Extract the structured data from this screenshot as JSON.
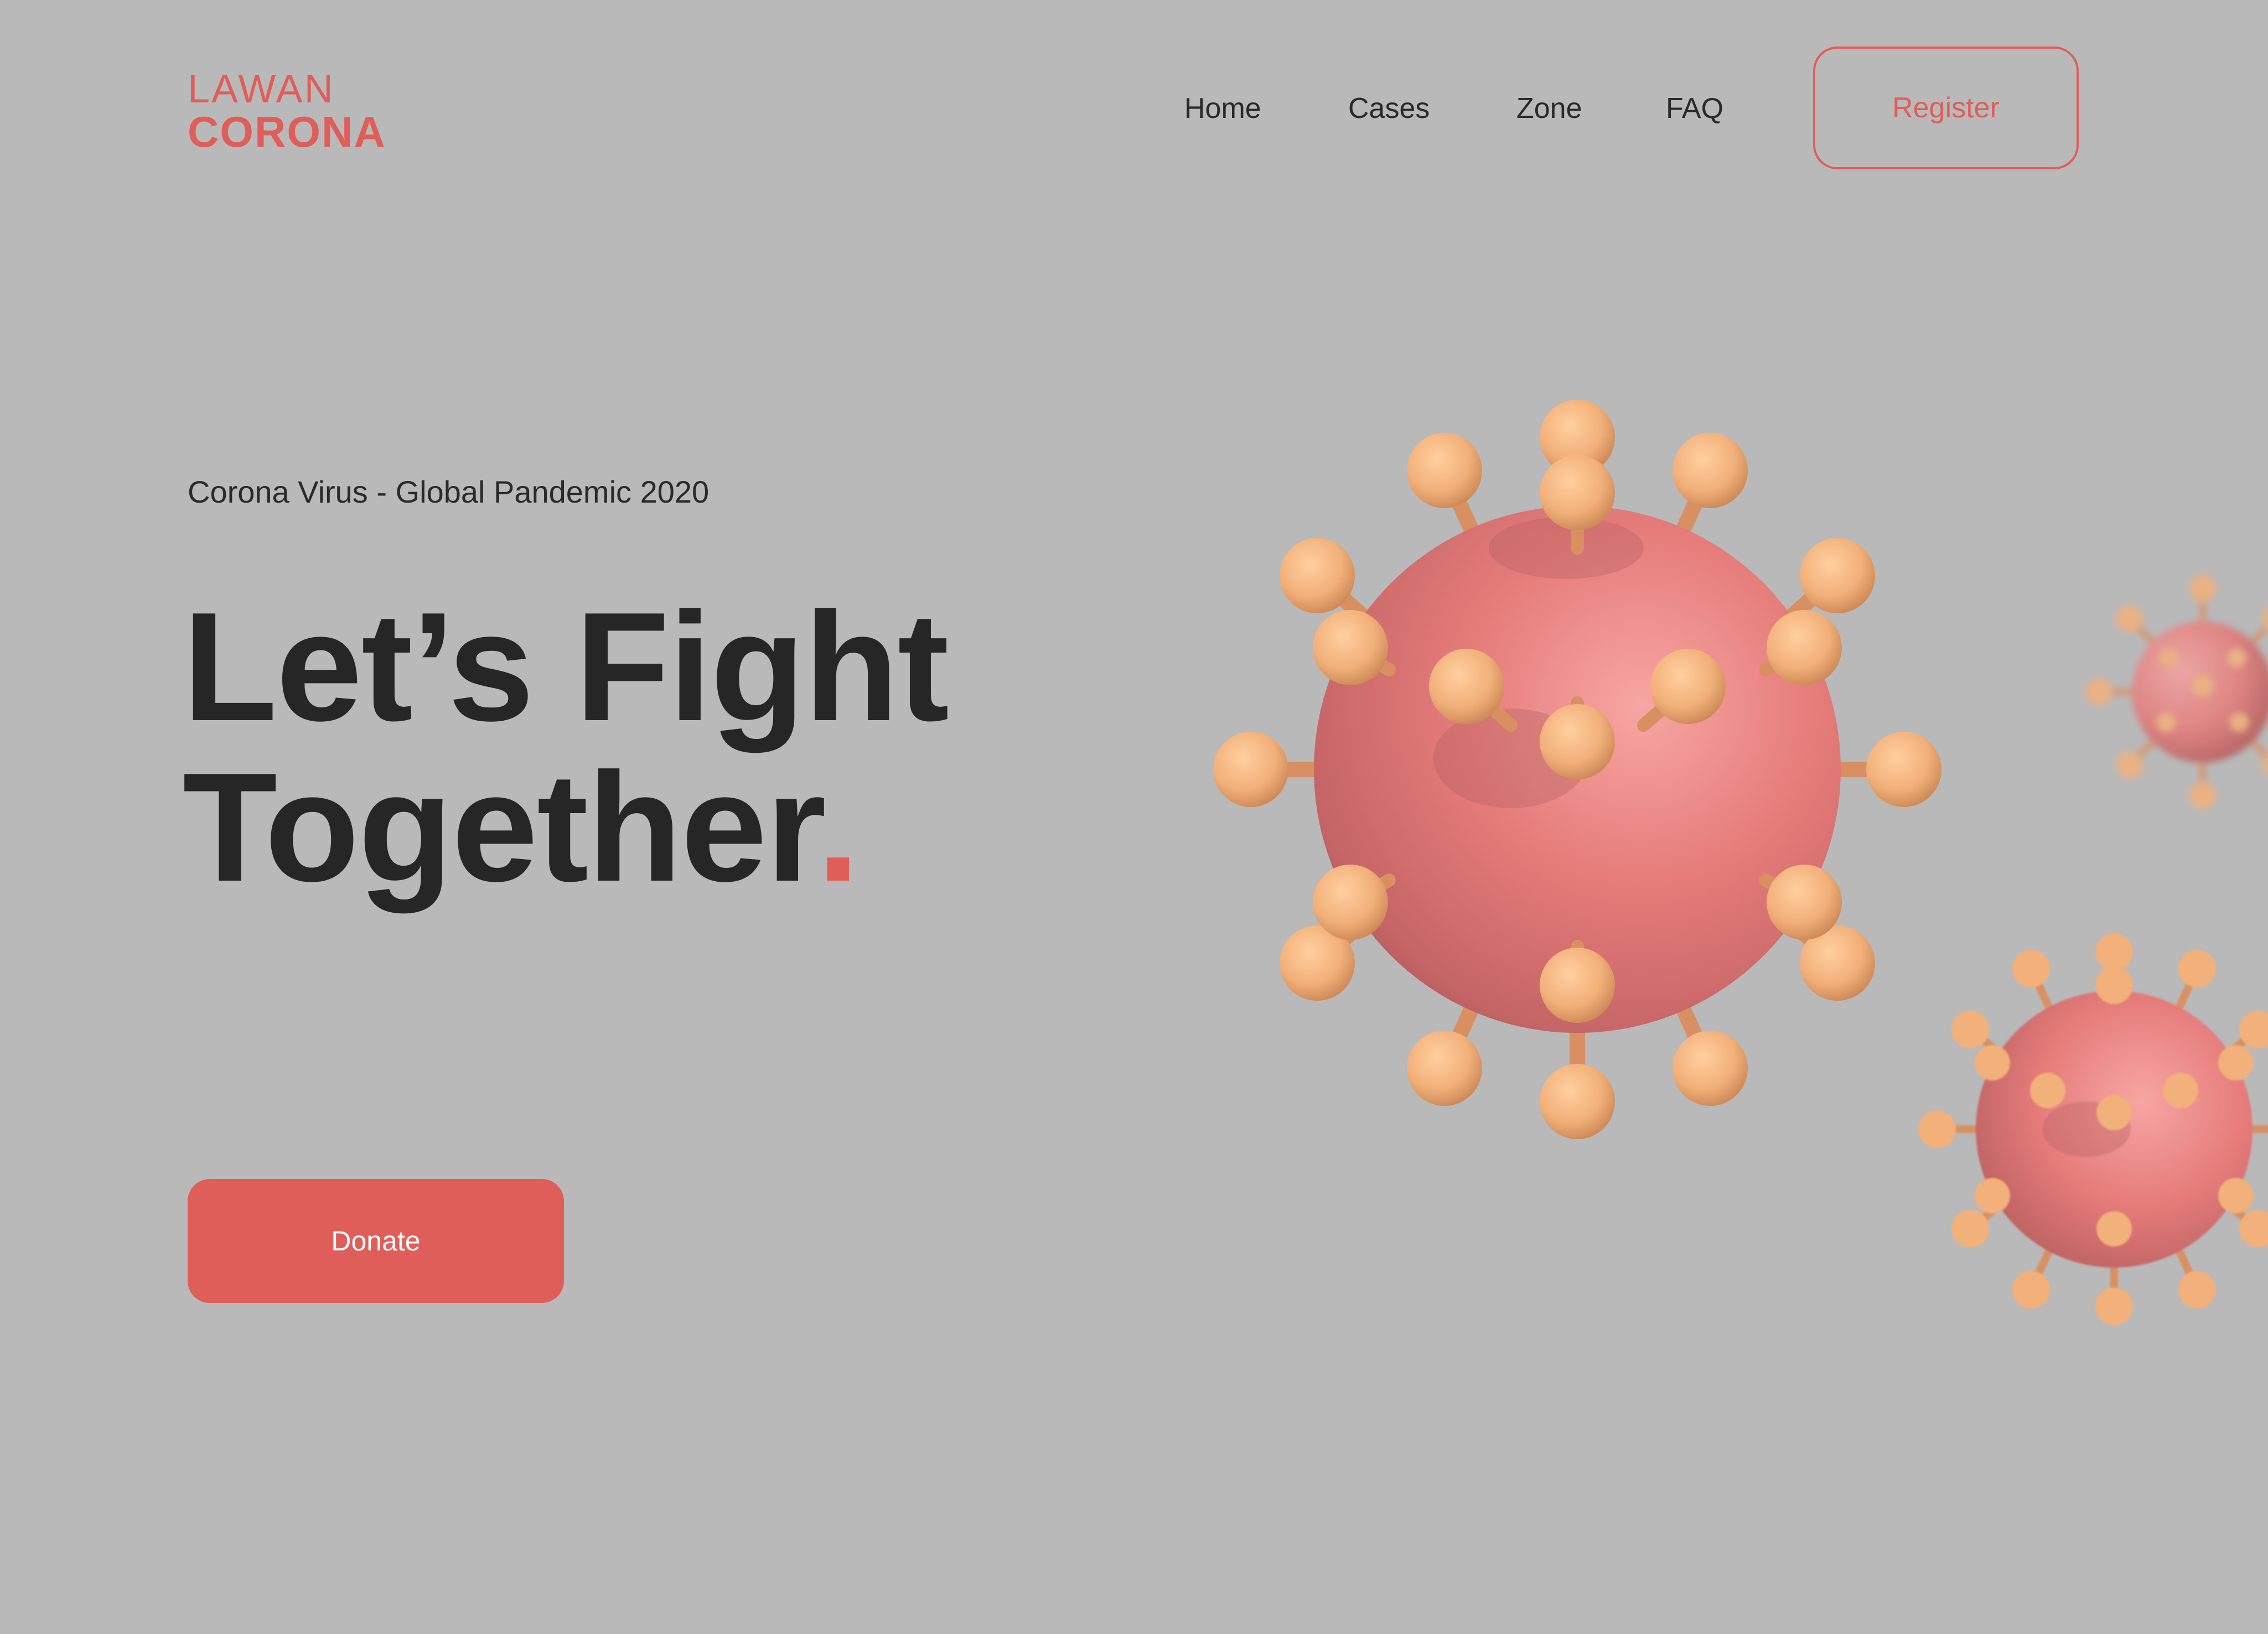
{
  "logo": {
    "line1": "LAWAN",
    "line2": "CORONA"
  },
  "nav": {
    "items": [
      {
        "label": "Home"
      },
      {
        "label": "Cases"
      },
      {
        "label": "Zone"
      },
      {
        "label": "FAQ"
      }
    ],
    "register_label": "Register"
  },
  "hero": {
    "subtitle": "Corona Virus - Global Pandemic 2020",
    "headline_line1": "Let’s Fight",
    "headline_line2": "Together",
    "headline_dot": ".",
    "donate_label": "Donate"
  },
  "colors": {
    "background": "#b9b9b9",
    "accent": "#e05e5a",
    "text": "#262626",
    "virus_body": "#e57c7a",
    "virus_spike": "#f2b07a"
  },
  "icons": {
    "main_illustration": "virus-icon",
    "secondary_illustration": "virus-icon",
    "background_illustration": "virus-icon"
  }
}
